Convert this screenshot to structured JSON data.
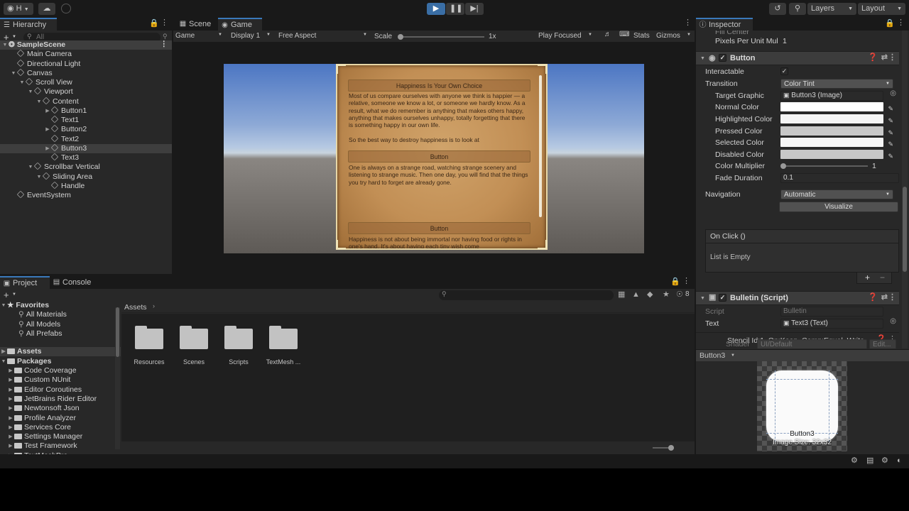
{
  "toolbar": {
    "account_label": "H",
    "play_icon": "play-icon",
    "pause_icon": "pause-icon",
    "step_icon": "step-icon",
    "layers_label": "Layers",
    "layout_label": "Layout",
    "play_color": "#3a6ea5"
  },
  "hierarchy": {
    "tab_label": "Hierarchy",
    "search_placeholder": "All",
    "items": [
      {
        "label": "SampleScene",
        "depth": 0,
        "kind": "scene"
      },
      {
        "label": "Main Camera",
        "depth": 1
      },
      {
        "label": "Directional Light",
        "depth": 1
      },
      {
        "label": "Canvas",
        "depth": 1,
        "expanded": true
      },
      {
        "label": "Scroll View",
        "depth": 2,
        "expanded": true
      },
      {
        "label": "Viewport",
        "depth": 3,
        "expanded": true
      },
      {
        "label": "Content",
        "depth": 4,
        "expanded": true
      },
      {
        "label": "Button1",
        "depth": 5,
        "collapsed": true
      },
      {
        "label": "Text1",
        "depth": 5
      },
      {
        "label": "Button2",
        "depth": 5,
        "collapsed": true
      },
      {
        "label": "Text2",
        "depth": 5
      },
      {
        "label": "Button3",
        "depth": 5,
        "collapsed": true,
        "selected": true
      },
      {
        "label": "Text3",
        "depth": 5
      },
      {
        "label": "Scrollbar Vertical",
        "depth": 3,
        "expanded": true
      },
      {
        "label": "Sliding Area",
        "depth": 4,
        "expanded": true
      },
      {
        "label": "Handle",
        "depth": 5
      },
      {
        "label": "EventSystem",
        "depth": 1
      }
    ]
  },
  "scene_view": {
    "tabs": [
      "Scene",
      "Game"
    ],
    "display_mode": "Game",
    "display": "Display 1",
    "aspect": "Free Aspect",
    "scale_label": "Scale",
    "scale_value": "1x",
    "play_focused": "Play Focused",
    "stats_label": "Stats",
    "gizmos_label": "Gizmos"
  },
  "game_content": {
    "title_button": "Happiness Is Your Own Choice",
    "paragraph1": "Most of us compare ourselves with anyone we think is happier — a relative, someone we know a lot, or someone we hardly know. As a result, what we do remember is anything that makes others happy, anything that makes ourselves unhappy, totally forgetting that there is something happy in our own life.",
    "paragraph1b": "So the best way to destroy happiness is to look at",
    "button2": "Button",
    "paragraph2": "One is always on a strange road, watching strange scenery and listening to strange music. Then one day, you will find that the things you try hard to forget are already gone.",
    "button3": "Button",
    "paragraph3": "Happiness is not about being immortal nor having food or rights in one's hand. It's about having each tiny wish come"
  },
  "inspector": {
    "tab_label": "Inspector",
    "top_partial": "Fill Center",
    "pixels_per_unit_label": "Pixels Per Unit Mul",
    "pixels_per_unit_value": "1",
    "button_component": "Button",
    "interactable_label": "Interactable",
    "transition_label": "Transition",
    "transition_value": "Color Tint",
    "target_graphic_label": "Target Graphic",
    "target_graphic_value": "Button3 (Image)",
    "normal_color_label": "Normal Color",
    "highlighted_color_label": "Highlighted Color",
    "pressed_color_label": "Pressed Color",
    "selected_color_label": "Selected Color",
    "disabled_color_label": "Disabled Color",
    "color_multiplier_label": "Color Multiplier",
    "color_multiplier_value": "1",
    "fade_duration_label": "Fade Duration",
    "fade_duration_value": "0.1",
    "navigation_label": "Navigation",
    "navigation_value": "Automatic",
    "visualize_label": "Visualize",
    "on_click_label": "On Click ()",
    "list_empty": "List is Empty",
    "plus_label": "+",
    "minus_label": "−",
    "bulletin_component": "Bulletin (Script)",
    "script_label": "Script",
    "script_value": "Bulletin",
    "text_label": "Text",
    "text_value": "Text3 (Text)",
    "stencil_info": "Stencil Id:1, Op:Keep, Comp:Equal, Write",
    "shader_label": "Shader",
    "shader_value": "UI/Default",
    "edit_label": "Edit...",
    "preview_name": "Button3",
    "preview_caption": "Button3",
    "preview_size": "Image Size: 32x32",
    "colors": {
      "normal": "#ffffff",
      "highlighted": "#f5f5f5",
      "pressed": "#c8c8c8",
      "selected": "#f5f5f5",
      "disabled": "#c8c8c8"
    }
  },
  "project": {
    "tabs": [
      "Project",
      "Console"
    ],
    "favorites_label": "Favorites",
    "favorites": [
      "All Materials",
      "All Models",
      "All Prefabs"
    ],
    "assets_label": "Assets",
    "packages_label": "Packages",
    "packages": [
      "Code Coverage",
      "Custom NUnit",
      "Editor Coroutines",
      "JetBrains Rider Editor",
      "Newtonsoft Json",
      "Profile Analyzer",
      "Services Core",
      "Settings Manager",
      "Test Framework",
      "TextMeshPro"
    ],
    "breadcrumb": "Assets",
    "folders": [
      "Resources",
      "Scenes",
      "Scripts",
      "TextMesh ..."
    ],
    "hidden_count": "8"
  }
}
